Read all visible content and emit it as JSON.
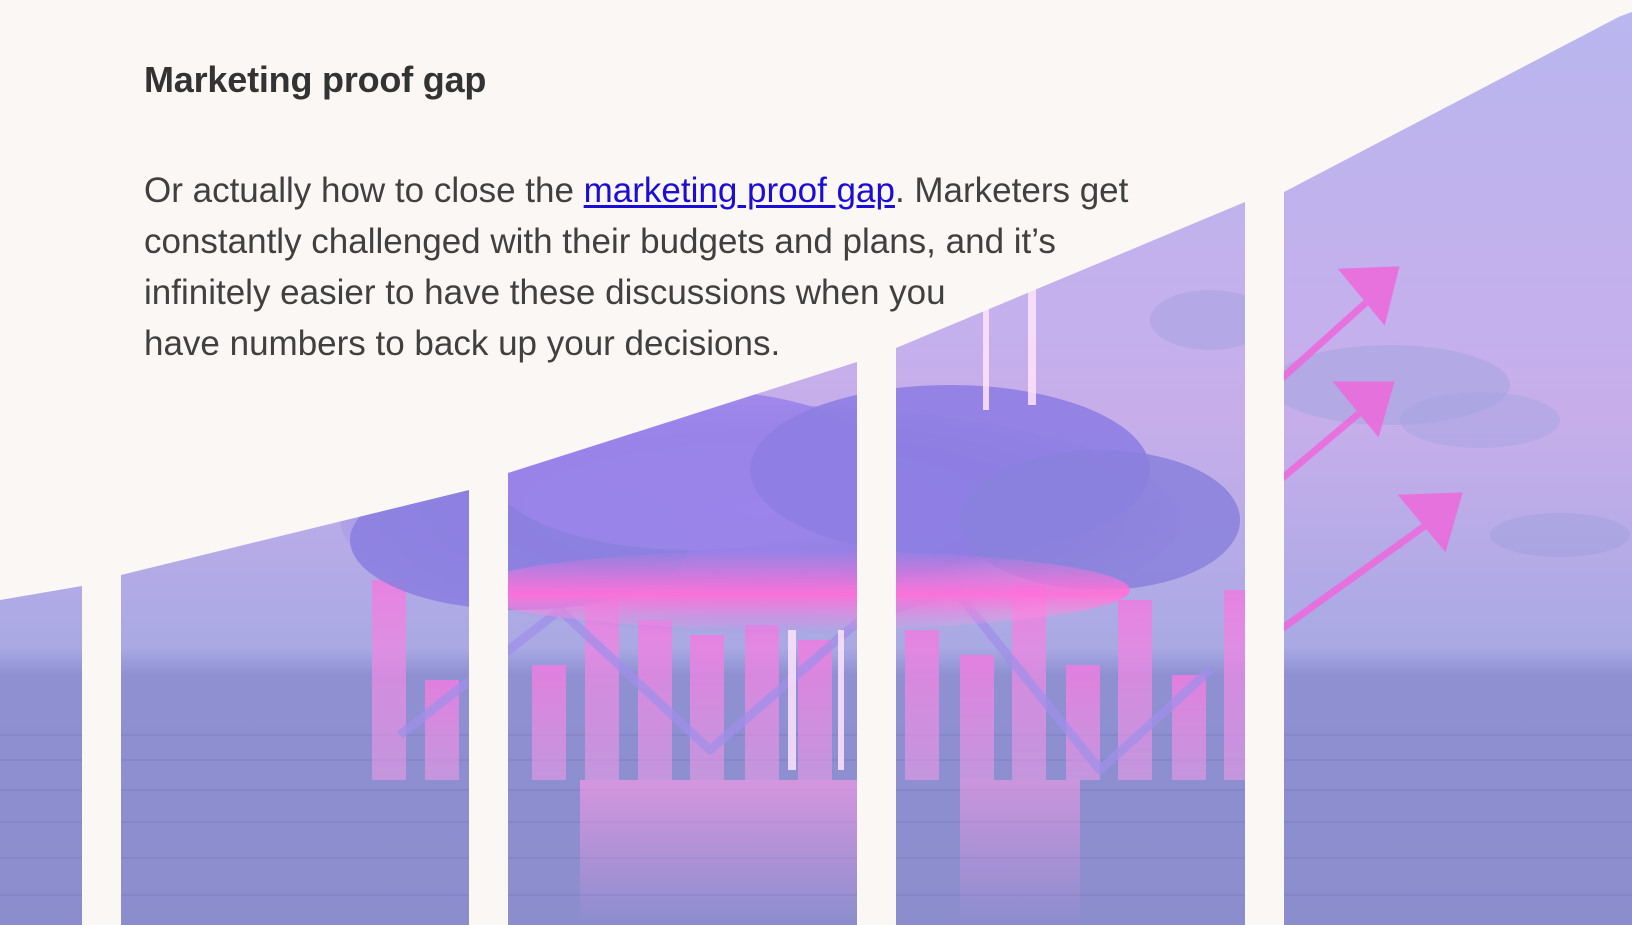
{
  "article": {
    "heading": "Marketing proof gap",
    "paragraph": {
      "before_link": "Or actually how to close the ",
      "link_text": "marketing proof gap",
      "after_link_line1": ". Marketers get constantly challenged with their budgets and plans, and it’s",
      "after_link_line2": "infinitely easier to have these discussions when you",
      "after_link_line3": "have numbers to back up your decisions."
    }
  },
  "hero_image": {
    "description_icon": "ascending-bars-cloud-icon",
    "colors": {
      "sky_top": "#b9b6ee",
      "sky_mid": "#c6a8ee",
      "sea": "#8f8fd0",
      "cloud": "#8f7fe0",
      "glow": "#ff78dd",
      "arrow": "#ee68dc",
      "gap": "#fbf7f5"
    }
  }
}
